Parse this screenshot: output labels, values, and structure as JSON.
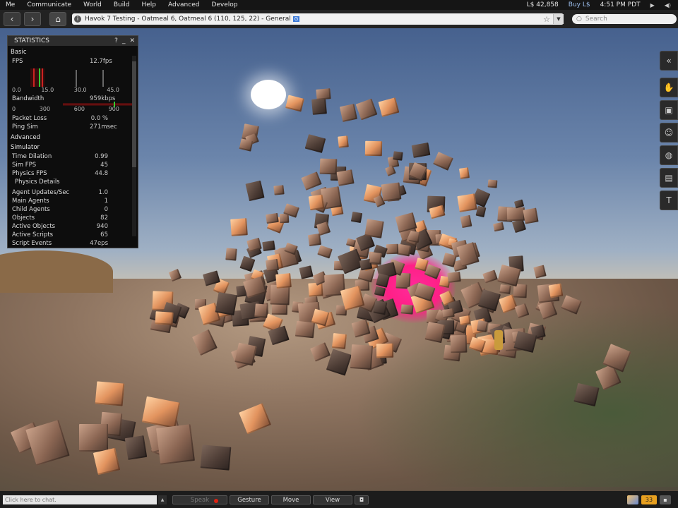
{
  "menubar": {
    "items": [
      "Me",
      "Communicate",
      "World",
      "Build",
      "Help",
      "Advanced",
      "Develop"
    ],
    "balance": "L$ 42,858",
    "buy": "Buy L$",
    "time": "4:51 PM PDT"
  },
  "navbar": {
    "location": "Havok 7 Testing - Oatmeal 6, Oatmeal 6 (110, 125, 22) - General",
    "rating_badge": "G",
    "search_placeholder": "Search"
  },
  "stats": {
    "title": "STATISTICS",
    "basic": "Basic",
    "fps_label": "FPS",
    "fps_value": "12.7fps",
    "fps_ticks": [
      "0.0",
      "15.0",
      "30.0",
      "45.0"
    ],
    "bandwidth_label": "Bandwidth",
    "bandwidth_value": "959kbps",
    "bandwidth_ticks": [
      "0",
      "300",
      "600",
      "900"
    ],
    "basic_rows": [
      {
        "label": "Packet Loss",
        "value": "0.0 %"
      },
      {
        "label": "Ping Sim",
        "value": "271msec"
      }
    ],
    "advanced": "Advanced",
    "simulator": "Simulator",
    "sim_rows": [
      {
        "label": "Time Dilation",
        "value": "0.99"
      },
      {
        "label": "Sim FPS",
        "value": "45"
      },
      {
        "label": "Physics FPS",
        "value": "44.8"
      }
    ],
    "physics_details": "Physics Details",
    "obj_rows": [
      {
        "label": "Agent Updates/Sec",
        "value": "1.0"
      },
      {
        "label": "Main Agents",
        "value": "1"
      },
      {
        "label": "Child Agents",
        "value": "0"
      },
      {
        "label": "Objects",
        "value": "82"
      },
      {
        "label": "Active Objects",
        "value": "940"
      },
      {
        "label": "Active Scripts",
        "value": "65"
      },
      {
        "label": "Script Events",
        "value": "47eps"
      }
    ]
  },
  "bottombar": {
    "chat_placeholder": "Click here to chat.",
    "speak": "Speak",
    "gesture": "Gesture",
    "move": "Move",
    "view": "View",
    "notifications": "33"
  }
}
